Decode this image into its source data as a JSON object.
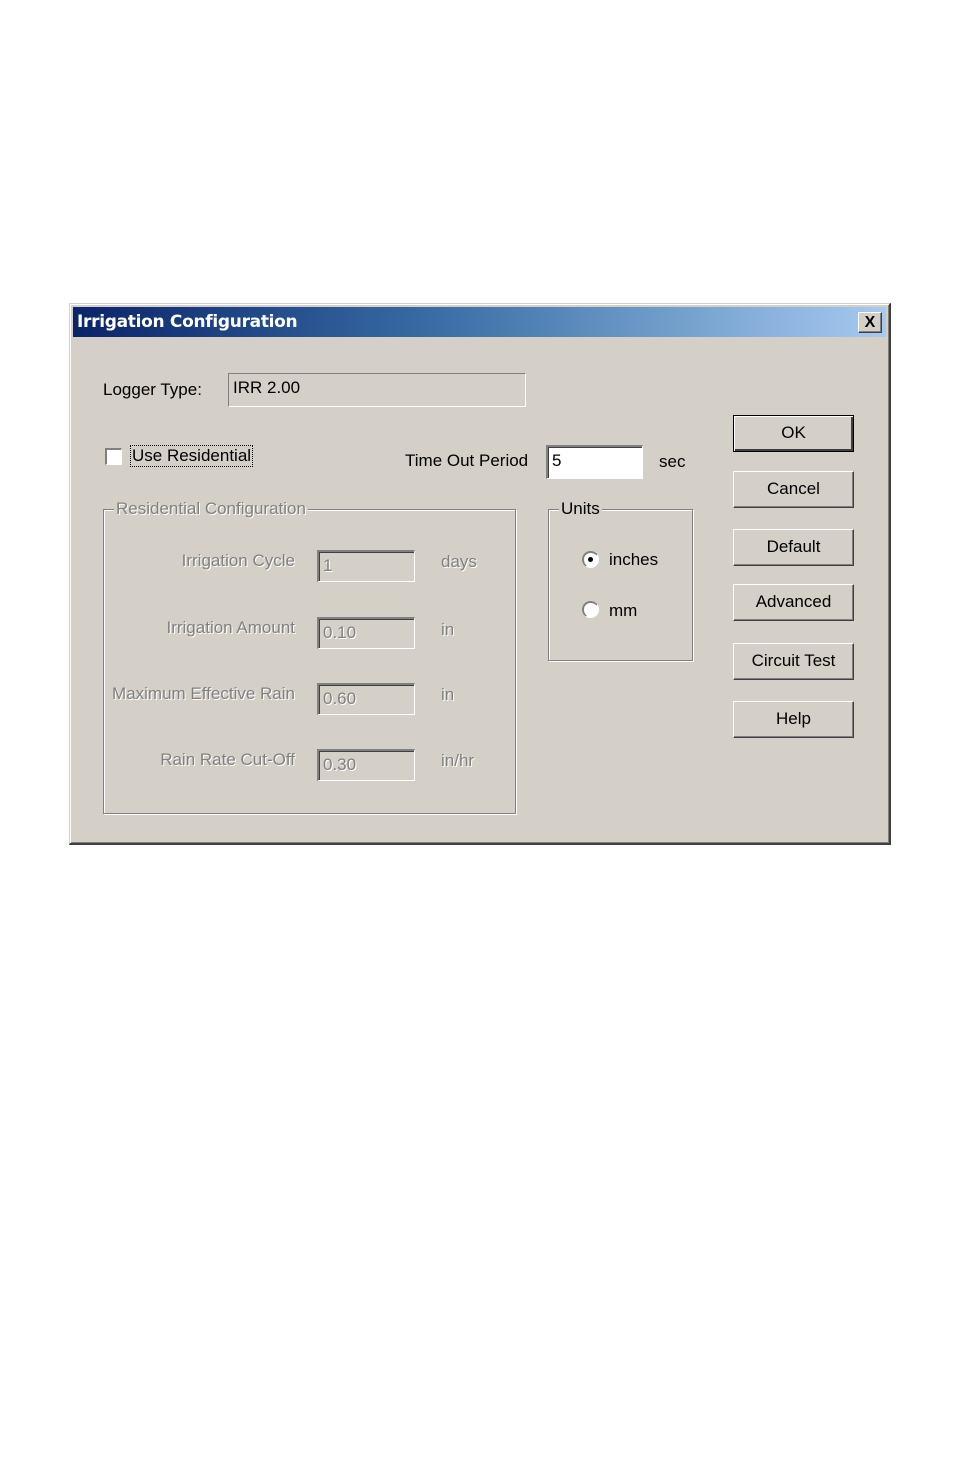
{
  "window": {
    "title": "Irrigation Configuration",
    "close_label": "X"
  },
  "logger_type": {
    "label": "Logger Type:",
    "value": "IRR  2.00"
  },
  "use_residential": {
    "label": "Use Residential",
    "checked": false
  },
  "timeout": {
    "label": "Time Out Period",
    "value": "5",
    "unit": "sec"
  },
  "residential_config": {
    "legend": "Residential Configuration",
    "fields": [
      {
        "label": "Irrigation Cycle",
        "value": "1",
        "unit": "days"
      },
      {
        "label": "Irrigation Amount",
        "value": "0.10",
        "unit": "in"
      },
      {
        "label": "Maximum Effective Rain",
        "value": "0.60",
        "unit": "in"
      },
      {
        "label": "Rain Rate Cut-Off",
        "value": "0.30",
        "unit": "in/hr"
      }
    ]
  },
  "units": {
    "legend": "Units",
    "options": [
      {
        "label": "inches",
        "selected": true
      },
      {
        "label": "mm",
        "selected": false
      }
    ]
  },
  "buttons": {
    "ok": "OK",
    "cancel": "Cancel",
    "default": "Default",
    "advanced": "Advanced",
    "circuit_test": "Circuit Test",
    "help": "Help"
  }
}
